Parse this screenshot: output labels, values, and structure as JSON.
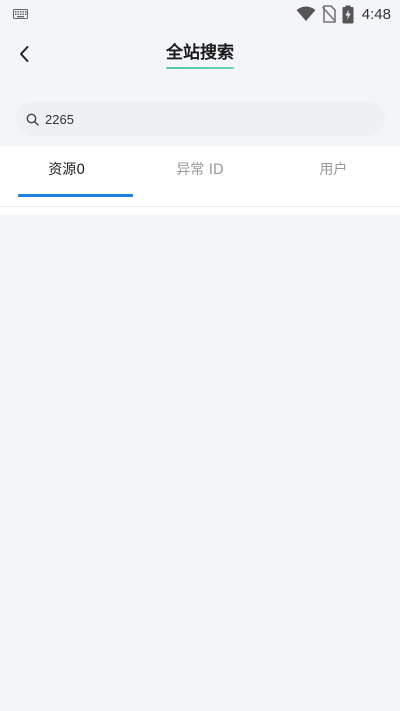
{
  "status_bar": {
    "time": "4:48",
    "icons": [
      "keyboard-icon",
      "wifi-icon",
      "no-sim-icon",
      "battery-charging-icon"
    ]
  },
  "header": {
    "title": "全站搜索",
    "back_icon": "chevron-left-icon"
  },
  "search": {
    "value": "2265",
    "icon": "search-icon"
  },
  "tabs": [
    {
      "label": "资源0",
      "active": true
    },
    {
      "label": "异常 ID",
      "active": false
    },
    {
      "label": "用户",
      "active": false
    }
  ],
  "colors": {
    "background": "#f4f5f9",
    "accent": "#1d7fe0",
    "title_underline": "#4fc8a0",
    "inactive_tab": "#999999"
  }
}
